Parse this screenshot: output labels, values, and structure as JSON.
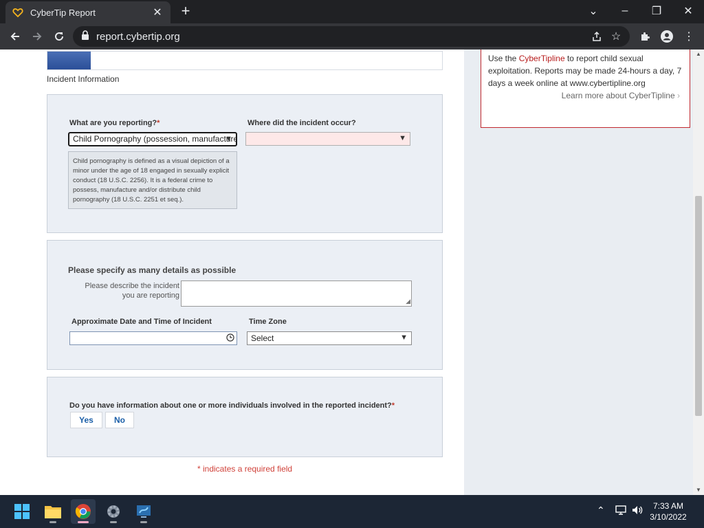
{
  "browser": {
    "tab_title": "CyberTip Report",
    "url": "report.cybertip.org"
  },
  "page": {
    "progress_percent": 11,
    "step_label": "Incident Information",
    "reporting": {
      "label": "What are you reporting?",
      "required_mark": "*",
      "selected": "Child Pornography (possession, manufacture",
      "description": "Child pornography is defined as a visual depiction of a minor under the age of 18 engaged in sexually explicit conduct (18 U.S.C. 2256). It is a federal crime to possess, manufacture and/or distribute child pornography (18 U.S.C. 2251 et seq.)."
    },
    "location": {
      "label": "Where did the incident occur?",
      "selected": ""
    },
    "details": {
      "title": "Please specify as many details as possible",
      "describe_label_1": "Please describe the incident",
      "describe_label_2": "you are reporting",
      "describe_value": "",
      "datetime_label": "Approximate Date and Time of Incident",
      "datetime_value": "",
      "timezone_label": "Time Zone",
      "timezone_selected": "Select"
    },
    "individuals": {
      "question": "Do you have information about one or more individuals involved in the reported incident?",
      "required_mark": "*",
      "yes_label": "Yes",
      "no_label": "No"
    },
    "required_note": "* indicates a required field",
    "sidebar": {
      "text_before": "Use the ",
      "link_text": "CyberTipline",
      "text_after": " to report child sexual exploitation. Reports may be made 24-hours a day, 7 days a week online at www.cybertipline.org",
      "learn_more": "Learn more about CyberTipline",
      "learn_more_arrow": "›"
    }
  },
  "taskbar": {
    "time": "7:33 AM",
    "date": "3/10/2022"
  },
  "colors": {
    "accent_red": "#c1272d",
    "progress_blue": "#2b4f98",
    "button_blue": "#1b5fa8"
  }
}
